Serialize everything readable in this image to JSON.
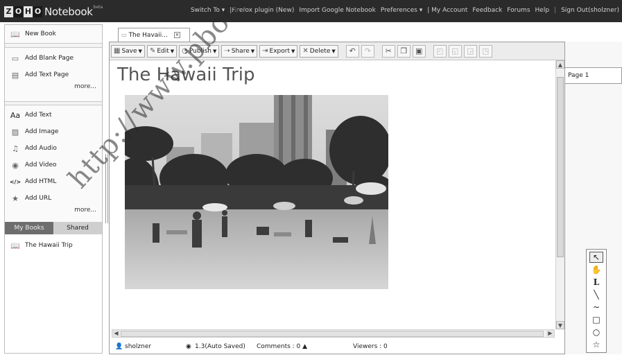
{
  "app": {
    "logo_letters": [
      "Z",
      "O",
      "H",
      "O"
    ],
    "logo_product": "Notebook",
    "logo_beta": "beta"
  },
  "topnav": {
    "switch_to": "Switch To ▾",
    "firefox": "|Firefox plugin (New)",
    "import": "Import Google Notebook",
    "preferences": "Preferences ▾",
    "my_account": "| My Account",
    "feedback": "Feedback",
    "forums": "Forums",
    "help": "Help",
    "sep": "|",
    "signout": "Sign Out(sholzner)"
  },
  "sidebar": {
    "new_book": "New Book",
    "page_items": [
      {
        "label": "Add Blank Page",
        "icon": "blank-page-icon"
      },
      {
        "label": "Add Text Page",
        "icon": "text-page-icon"
      }
    ],
    "more_pages": "more...",
    "content_items": [
      {
        "label": "Add Text",
        "icon": "text-icon"
      },
      {
        "label": "Add Image",
        "icon": "image-icon"
      },
      {
        "label": "Add Audio",
        "icon": "audio-icon"
      },
      {
        "label": "Add Video",
        "icon": "video-icon"
      },
      {
        "label": "Add HTML",
        "icon": "html-icon"
      },
      {
        "label": "Add URL",
        "icon": "url-icon"
      }
    ],
    "more_content": "more...",
    "tabs": {
      "my_books": "My Books",
      "shared": "Shared"
    },
    "books": [
      {
        "label": "The Hawaii Trip"
      }
    ]
  },
  "doc_tab": {
    "label": "The Havaii..."
  },
  "toolbar": {
    "save": "Save",
    "edit": "Edit",
    "publish": "Publish",
    "share": "Share",
    "export": "Export",
    "delete": "Delete"
  },
  "page": {
    "title": "The Hawaii Trip"
  },
  "status": {
    "user": "sholzner",
    "version": "1.3(Auto Saved)",
    "comments": "Comments : 0 ▲",
    "viewers": "Viewers : 0"
  },
  "pages": [
    {
      "label": "Page 1"
    }
  ],
  "watermark": {
    "text": "http://www.pbookshop.com"
  }
}
